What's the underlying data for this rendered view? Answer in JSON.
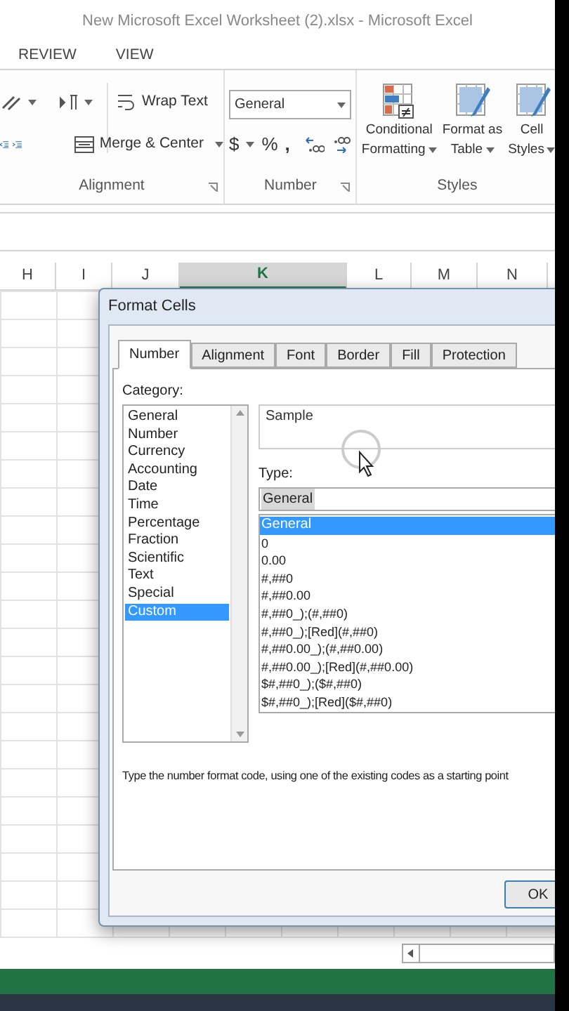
{
  "window": {
    "title": "New Microsoft Excel Worksheet (2).xlsx - Microsoft Excel"
  },
  "ribbon_tabs": [
    {
      "label": "REVIEW",
      "selected": false
    },
    {
      "label": "VIEW",
      "selected": false
    }
  ],
  "ribbon": {
    "alignment": {
      "wrap_text": "Wrap Text",
      "merge_center": "Merge & Center",
      "label": "Alignment"
    },
    "number": {
      "format": "General",
      "currency": "$",
      "percent": "%",
      "comma": ",",
      "label": "Number"
    },
    "styles": {
      "buttons": [
        {
          "line1": "Conditional",
          "line2": "Formatting"
        },
        {
          "line1": "Format as",
          "line2": "Table"
        },
        {
          "line1": "Cell",
          "line2": "Styles"
        }
      ],
      "label": "Styles"
    }
  },
  "column_headers": [
    {
      "label": "H",
      "selected": false
    },
    {
      "label": "I",
      "selected": false
    },
    {
      "label": "J",
      "selected": false
    },
    {
      "label": "K",
      "selected": true
    },
    {
      "label": "L",
      "selected": false
    },
    {
      "label": "M",
      "selected": false
    },
    {
      "label": "N",
      "selected": false
    }
  ],
  "dialog": {
    "title": "Format Cells",
    "tabs": [
      {
        "label": "Number",
        "selected": true
      },
      {
        "label": "Alignment",
        "selected": false
      },
      {
        "label": "Font",
        "selected": false
      },
      {
        "label": "Border",
        "selected": false
      },
      {
        "label": "Fill",
        "selected": false
      },
      {
        "label": "Protection",
        "selected": false
      }
    ],
    "category_label": "Category:",
    "categories": [
      {
        "label": "General",
        "selected": false
      },
      {
        "label": "Number",
        "selected": false
      },
      {
        "label": "Currency",
        "selected": false
      },
      {
        "label": "Accounting",
        "selected": false
      },
      {
        "label": "Date",
        "selected": false
      },
      {
        "label": "Time",
        "selected": false
      },
      {
        "label": "Percentage",
        "selected": false
      },
      {
        "label": "Fraction",
        "selected": false
      },
      {
        "label": "Scientific",
        "selected": false
      },
      {
        "label": "Text",
        "selected": false
      },
      {
        "label": "Special",
        "selected": false
      },
      {
        "label": "Custom",
        "selected": true
      }
    ],
    "sample_label": "Sample",
    "type_label": "Type:",
    "type_value": "General",
    "type_options": [
      {
        "label": "General",
        "selected": true
      },
      {
        "label": "0",
        "selected": false
      },
      {
        "label": "0.00",
        "selected": false
      },
      {
        "label": "#,##0",
        "selected": false
      },
      {
        "label": "#,##0.00",
        "selected": false
      },
      {
        "label": "#,##0_);(#,##0)",
        "selected": false
      },
      {
        "label": "#,##0_);[Red](#,##0)",
        "selected": false
      },
      {
        "label": "#,##0.00_);(#,##0.00)",
        "selected": false
      },
      {
        "label": "#,##0.00_);[Red](#,##0.00)",
        "selected": false
      },
      {
        "label": "$#,##0_);($#,##0)",
        "selected": false
      },
      {
        "label": "$#,##0_);[Red]($#,##0)",
        "selected": false
      }
    ],
    "description": "Type the number format code, using one of the existing codes as a starting point",
    "buttons": [
      "OK"
    ]
  }
}
